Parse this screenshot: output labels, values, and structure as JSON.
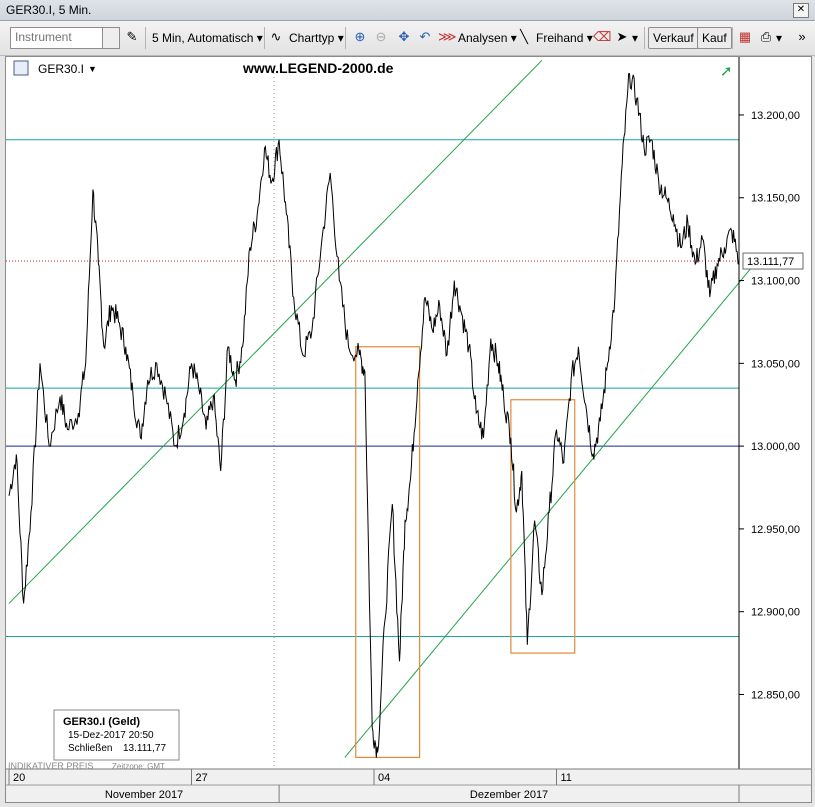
{
  "window": {
    "title": "GER30.I, 5 Min."
  },
  "toolbar": {
    "instrument_placeholder": "Instrument",
    "interval_label": "5 Min,  Automatisch",
    "charttype_label": "Charttyp",
    "analysen_label": "Analysen",
    "freihand_label": "Freihand",
    "sell_label": "Verkauf",
    "buy_label": "Kauf"
  },
  "chart": {
    "symbol": "GER30.I",
    "watermark": "www.LEGEND-2000.de",
    "current_price_label": "13.111,77",
    "colors": {
      "price": "#000000",
      "horizontal": "#1ba3a8",
      "support": "#1a2a8a",
      "trend": "#23a446",
      "box": "#e08a3a",
      "price_marker": "#c02020"
    },
    "info_box": {
      "title": "GER30.I (Geld)",
      "datetime": "15-Dez-2017 20:50",
      "close_label": "Schließen",
      "close_value": "13.111,77"
    },
    "footer_left": "INDIKATIVER PREIS",
    "footer_zone": "Zeitzone: GMT"
  },
  "chart_data": {
    "type": "line",
    "symbol": "GER30.I",
    "ylim": [
      12805,
      13235
    ],
    "yticks": [
      12850,
      12900,
      12950,
      13000,
      13050,
      13100,
      13150,
      13200
    ],
    "ytick_labels": [
      "12.850,00",
      "12.900,00",
      "12.950,00",
      "13.000,00",
      "13.050,00",
      "13.100,00",
      "13.150,00",
      "13.200,00"
    ],
    "day_labels": [
      "20",
      "27",
      "04",
      "11"
    ],
    "day_label_positions": [
      0.5,
      5.5,
      10.5,
      15.5
    ],
    "month_labels": [
      "November 2017",
      "Dezember 2017"
    ],
    "trading_days": 20,
    "horizontal_lines": [
      {
        "value": 13185,
        "kind": "resistance"
      },
      {
        "value": 13035,
        "kind": "resistance"
      },
      {
        "value": 13000,
        "kind": "support"
      },
      {
        "value": 12885,
        "kind": "resistance"
      }
    ],
    "current_price": 13111.77,
    "trend_lines": [
      {
        "from": [
          0.0,
          12905
        ],
        "to": [
          14.6,
          13233
        ]
      },
      {
        "from": [
          9.2,
          12812
        ],
        "to": [
          20.5,
          13112
        ]
      }
    ],
    "boxes": [
      {
        "x0": 9.5,
        "x1": 11.25,
        "y0": 12812,
        "y1": 13060
      },
      {
        "x0": 13.75,
        "x1": 15.5,
        "y0": 12875,
        "y1": 13028
      }
    ],
    "series": [
      {
        "values": [
          [
            0.0,
            12970
          ],
          [
            0.2,
            12995
          ],
          [
            0.4,
            12905
          ],
          [
            0.6,
            12960
          ],
          [
            0.85,
            13050
          ],
          [
            1.1,
            13000
          ],
          [
            1.4,
            13030
          ],
          [
            1.6,
            13010
          ],
          [
            1.9,
            13020
          ],
          [
            2.1,
            13050
          ],
          [
            2.3,
            13155
          ],
          [
            2.45,
            13110
          ],
          [
            2.6,
            13060
          ],
          [
            2.8,
            13085
          ],
          [
            3.0,
            13075
          ],
          [
            3.2,
            13060
          ],
          [
            3.4,
            13030
          ],
          [
            3.6,
            13005
          ],
          [
            3.8,
            13040
          ],
          [
            4.05,
            13050
          ],
          [
            4.3,
            13030
          ],
          [
            4.55,
            13000
          ],
          [
            4.8,
            13020
          ],
          [
            5.0,
            13050
          ],
          [
            5.2,
            13035
          ],
          [
            5.4,
            13010
          ],
          [
            5.6,
            13030
          ],
          [
            5.8,
            12985
          ],
          [
            6.0,
            13060
          ],
          [
            6.2,
            13040
          ],
          [
            6.4,
            13060
          ],
          [
            6.6,
            13120
          ],
          [
            6.8,
            13140
          ],
          [
            7.0,
            13180
          ],
          [
            7.2,
            13160
          ],
          [
            7.4,
            13185
          ],
          [
            7.6,
            13140
          ],
          [
            7.8,
            13090
          ],
          [
            8.05,
            13055
          ],
          [
            8.3,
            13070
          ],
          [
            8.55,
            13120
          ],
          [
            8.8,
            13165
          ],
          [
            9.05,
            13100
          ],
          [
            9.3,
            13060
          ],
          [
            9.6,
            13055
          ],
          [
            9.75,
            13045
          ],
          [
            9.95,
            12830
          ],
          [
            10.1,
            12815
          ],
          [
            10.3,
            12895
          ],
          [
            10.5,
            12965
          ],
          [
            10.7,
            12870
          ],
          [
            10.85,
            12955
          ],
          [
            11.0,
            12980
          ],
          [
            11.2,
            13040
          ],
          [
            11.4,
            13090
          ],
          [
            11.6,
            13070
          ],
          [
            11.8,
            13085
          ],
          [
            12.0,
            13055
          ],
          [
            12.2,
            13100
          ],
          [
            12.4,
            13080
          ],
          [
            12.6,
            13060
          ],
          [
            12.8,
            13020
          ],
          [
            13.0,
            13005
          ],
          [
            13.2,
            13065
          ],
          [
            13.4,
            13050
          ],
          [
            13.55,
            13030
          ],
          [
            13.75,
            13005
          ],
          [
            13.9,
            12960
          ],
          [
            14.05,
            12985
          ],
          [
            14.2,
            12880
          ],
          [
            14.4,
            12955
          ],
          [
            14.6,
            12910
          ],
          [
            14.8,
            12960
          ],
          [
            15.0,
            13010
          ],
          [
            15.2,
            12990
          ],
          [
            15.4,
            13040
          ],
          [
            15.6,
            13060
          ],
          [
            15.8,
            13025
          ],
          [
            16.0,
            12995
          ],
          [
            16.2,
            13015
          ],
          [
            16.4,
            13050
          ],
          [
            16.6,
            13090
          ],
          [
            16.8,
            13170
          ],
          [
            17.0,
            13225
          ],
          [
            17.2,
            13210
          ],
          [
            17.4,
            13180
          ],
          [
            17.6,
            13185
          ],
          [
            17.8,
            13160
          ],
          [
            18.0,
            13150
          ],
          [
            18.2,
            13140
          ],
          [
            18.4,
            13120
          ],
          [
            18.6,
            13135
          ],
          [
            18.8,
            13110
          ],
          [
            19.0,
            13125
          ],
          [
            19.2,
            13090
          ],
          [
            19.4,
            13110
          ],
          [
            19.6,
            13120
          ],
          [
            19.8,
            13130
          ],
          [
            20.0,
            13112
          ]
        ]
      }
    ]
  }
}
